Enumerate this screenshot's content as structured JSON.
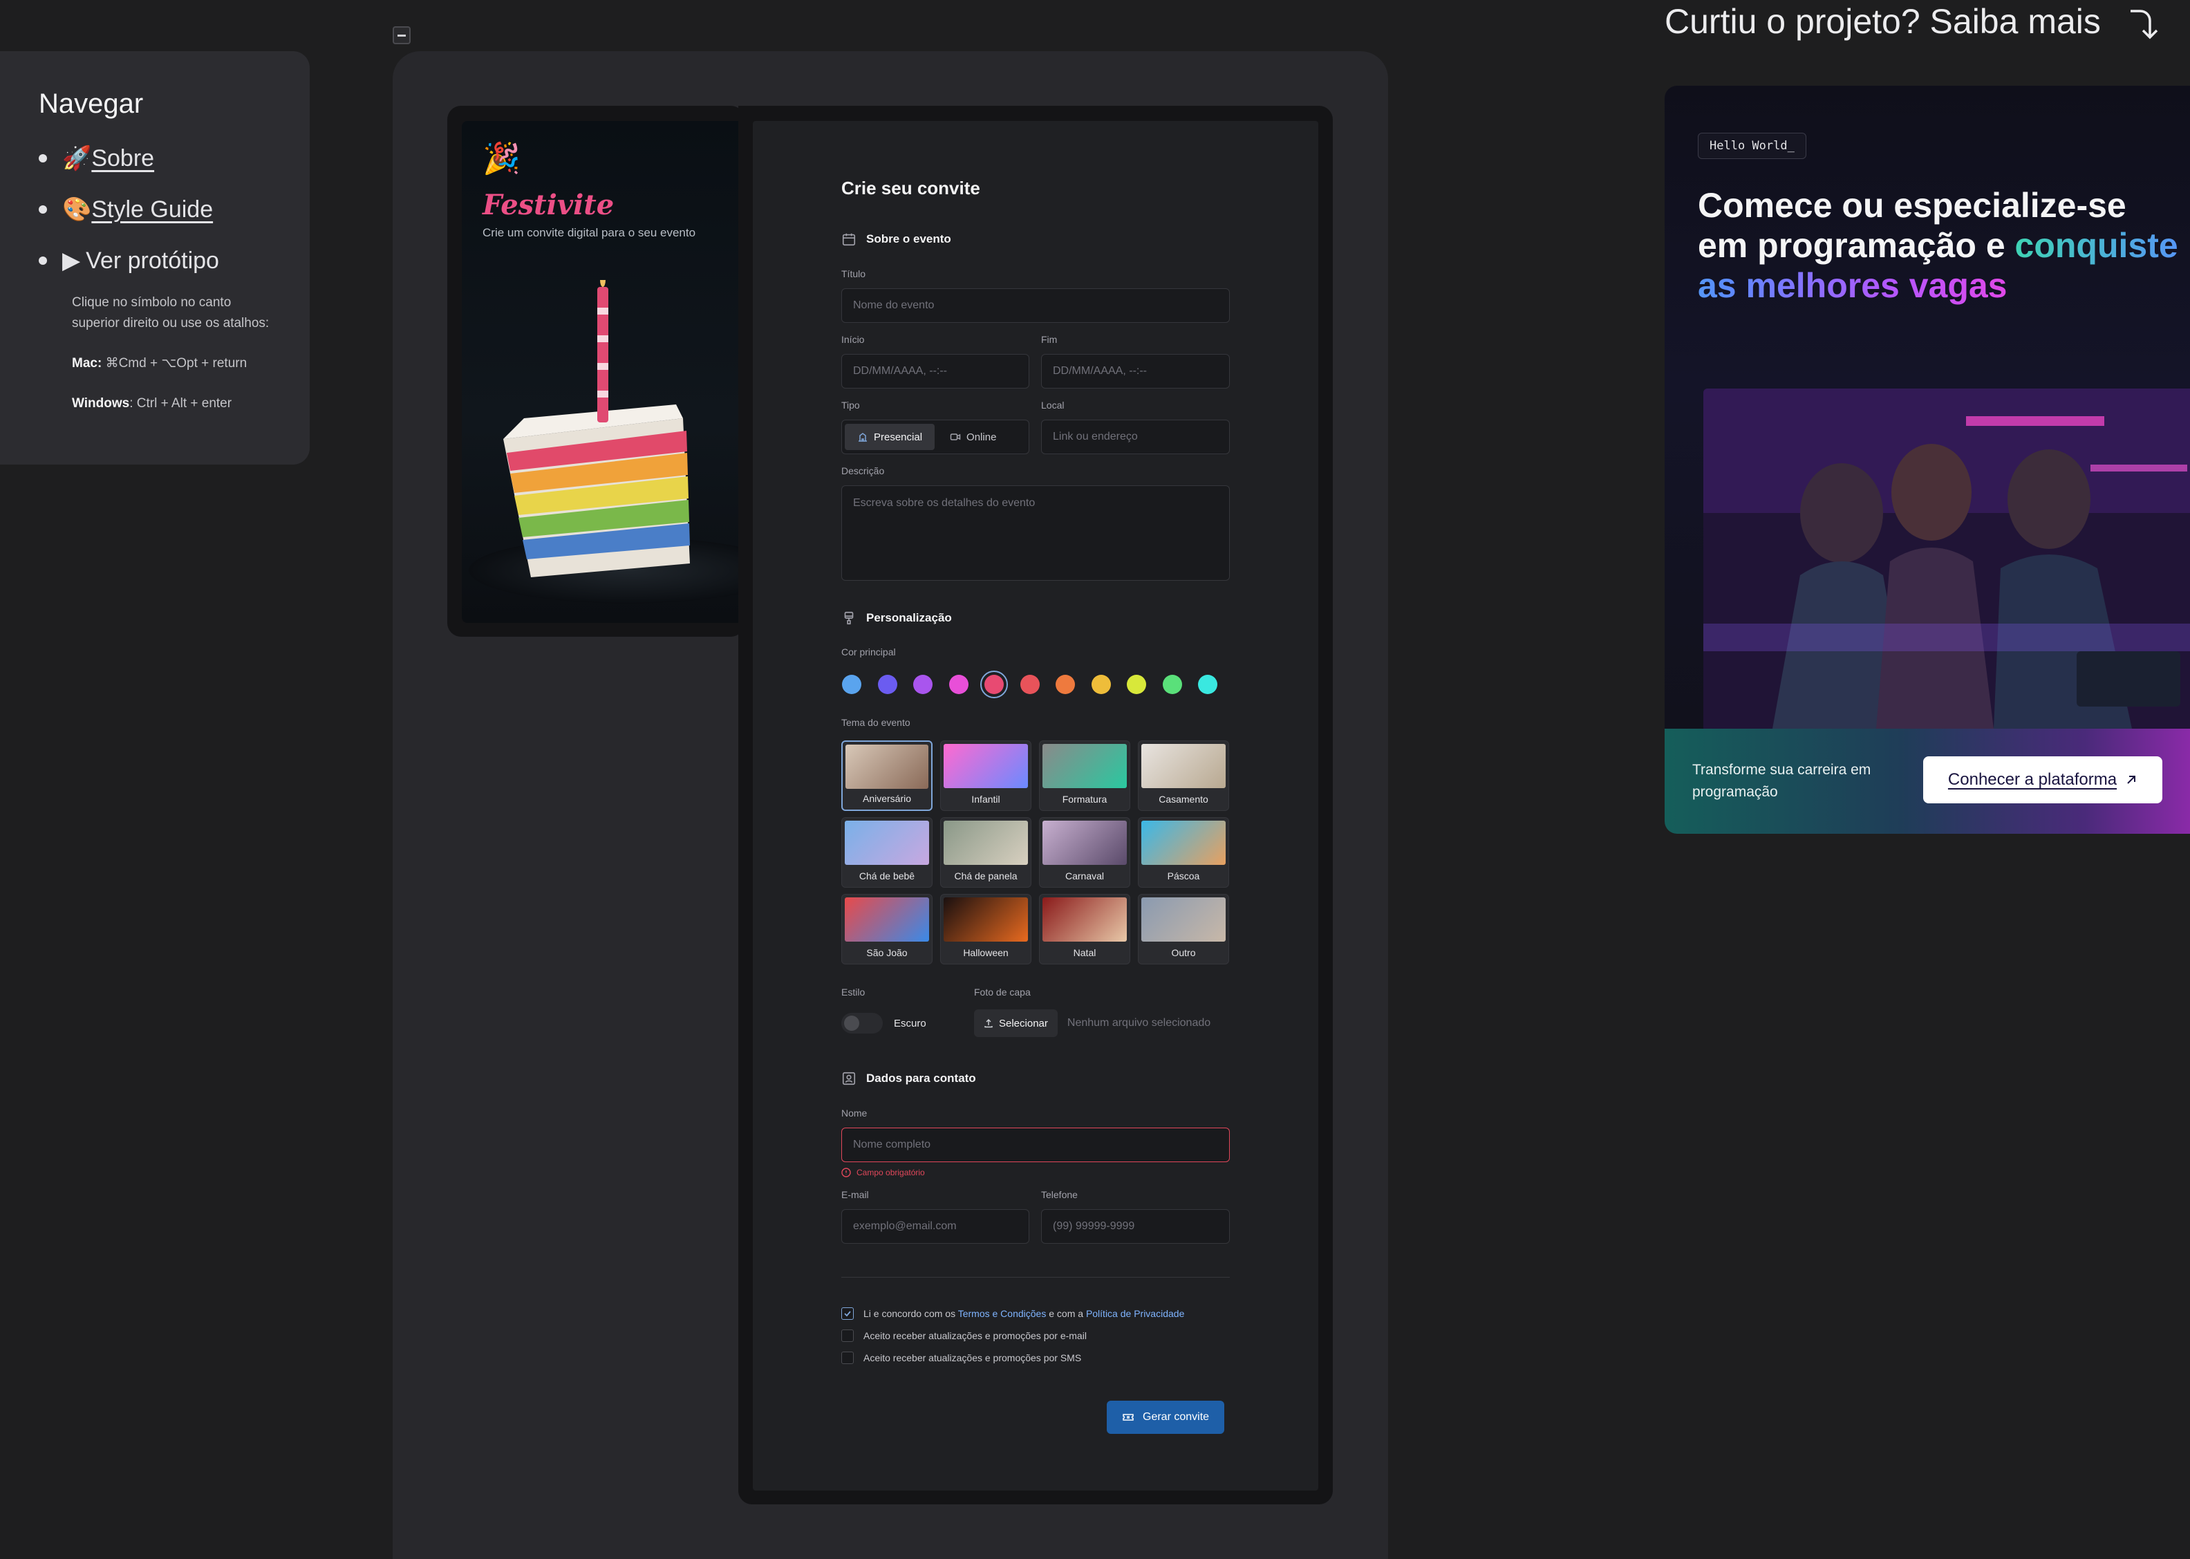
{
  "nav": {
    "title": "Navegar",
    "items": [
      {
        "emoji": "🚀",
        "label": "Sobre"
      },
      {
        "emoji": "🎨",
        "label": "Style Guide"
      },
      {
        "emoji": "▶",
        "label": "Ver protótipo"
      }
    ],
    "hint": "Clique no símbolo no canto superior direito ou use os atalhos:",
    "mac_label": "Mac:",
    "mac_keys": "⌘Cmd + ⌥Opt + return",
    "win_label": "Windows",
    "win_keys": ": Ctrl + Alt + enter"
  },
  "preview": {
    "icon": "🎉",
    "brand": "Festivite",
    "tagline": "Crie um convite digital para o seu evento"
  },
  "form": {
    "title": "Crie seu convite",
    "section_event": "Sobre o evento",
    "title_label": "Título",
    "title_placeholder": "Nome do evento",
    "start_label": "Início",
    "start_placeholder": "DD/MM/AAAA, --:--",
    "end_label": "Fim",
    "end_placeholder": "DD/MM/AAAA, --:--",
    "type_label": "Tipo",
    "type_options": [
      "Presencial",
      "Online"
    ],
    "type_selected": "Presencial",
    "place_label": "Local",
    "place_placeholder": "Link ou endereço",
    "desc_label": "Descrição",
    "desc_placeholder": "Escreva sobre os detalhes do evento",
    "section_custom": "Personalização",
    "color_label": "Cor principal",
    "colors": [
      "#5aa4ee",
      "#6b5cf0",
      "#a955ee",
      "#e84fd8",
      "#e84a72",
      "#e8535a",
      "#ee7a3e",
      "#eebd3a",
      "#d8e83a",
      "#5ae07a",
      "#3ae8e0"
    ],
    "selected_color_index": 4,
    "theme_label": "Tema do evento",
    "themes": [
      "Aniversário",
      "Infantil",
      "Formatura",
      "Casamento",
      "Chá de bebê",
      "Chá de panela",
      "Carnaval",
      "Páscoa",
      "São João",
      "Halloween",
      "Natal",
      "Outro"
    ],
    "selected_theme": "Aniversário",
    "style_label": "Estilo",
    "style_value": "Escuro",
    "cover_label": "Foto de capa",
    "cover_button": "Selecionar",
    "cover_status": "Nenhum arquivo selecionado",
    "section_contact": "Dados para contato",
    "name_label": "Nome",
    "name_placeholder": "Nome completo",
    "name_error": "Campo obrigatório",
    "email_label": "E-mail",
    "email_placeholder": "exemplo@email.com",
    "phone_label": "Telefone",
    "phone_placeholder": "(99) 99999-9999",
    "terms_prefix": "Li e concordo com os ",
    "terms_link": "Termos e Condições",
    "terms_mid": " e com a ",
    "privacy_link": "Política de Privacidade",
    "opt_email": "Aceito receber atualizações e promoções por e-mail",
    "opt_sms": "Aceito receber atualizações e promoções por SMS",
    "submit": "Gerar convite"
  },
  "promo": {
    "title": "Curtiu o projeto? Saiba mais",
    "badge": "Hello World_",
    "head_plain": "Comece ou especialize-se em programação e ",
    "head_grad": "conquiste as melhores vagas",
    "sub": "Transforme sua carreira em programação",
    "cta": "Conhecer a plataforma"
  }
}
